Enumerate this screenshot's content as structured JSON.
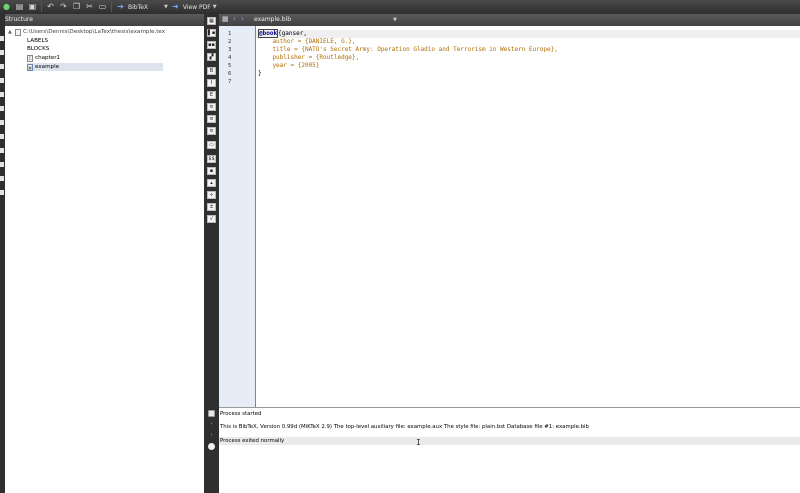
{
  "toolbar": {
    "compile_combo": "BibTeX",
    "view_combo": "View PDF"
  },
  "structure": {
    "header": "Structure",
    "root_path": "C:\\Users\\Dennis\\Desktop\\LaTex\\thesis\\example.tex",
    "items": [
      {
        "label": "LABELS"
      },
      {
        "label": "BLOCKS"
      },
      {
        "label": "chapter1"
      },
      {
        "label": "example"
      }
    ]
  },
  "editor": {
    "tab_label": "example.bib",
    "line_numbers": [
      "1",
      "2",
      "3",
      "4",
      "5",
      "6",
      "7"
    ],
    "lines": [
      {
        "kw": "@book",
        "rest": "{ganser,"
      },
      {
        "text": "    author = {DANIELE, G.},"
      },
      {
        "text": "    title = {NATO's Secret Army: Operation Gladio and Terrorism in Western Europe},"
      },
      {
        "text": "    publisher = {Routledge},"
      },
      {
        "text": "    year = {2005}"
      },
      {
        "plain": "}"
      },
      {
        "plain": ""
      }
    ]
  },
  "console": {
    "lines": [
      "Process started",
      "This is BibTeX, Version 0.99d (MiKTeX 2.9) The top-level auxiliary file: example.aux The style file: plain.bst Database file #1: example.bib",
      "Process exited normally"
    ]
  },
  "colors": {
    "bibtex_string": "#b16d00",
    "bibtex_keyword": "#00008b",
    "gutter_bg": "#e6edf7",
    "chrome_dark": "#3a3a3a"
  }
}
